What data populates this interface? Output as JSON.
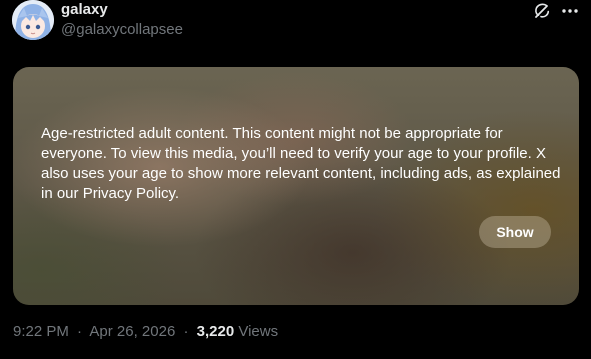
{
  "author": {
    "display_name": "galaxy",
    "handle": "@galaxycollapsee"
  },
  "header_icons": {
    "grok": "grok-icon",
    "more": "more-dots-icon"
  },
  "media": {
    "warning_text": "Age-restricted adult content. This content might not be appropriate for everyone. To view this media, you’ll need to verify your age to your profile. X also uses your age to show more relevant content, including ads, as explained in our Privacy Policy.",
    "show_label": "Show"
  },
  "meta": {
    "time": "9:22 PM",
    "date": "Apr 26, 2026",
    "separator": "·",
    "views_count": "3,220",
    "views_label": "Views"
  },
  "colors": {
    "background": "#000000",
    "primary_text": "#e7e9ea",
    "secondary_text": "#71767b"
  }
}
